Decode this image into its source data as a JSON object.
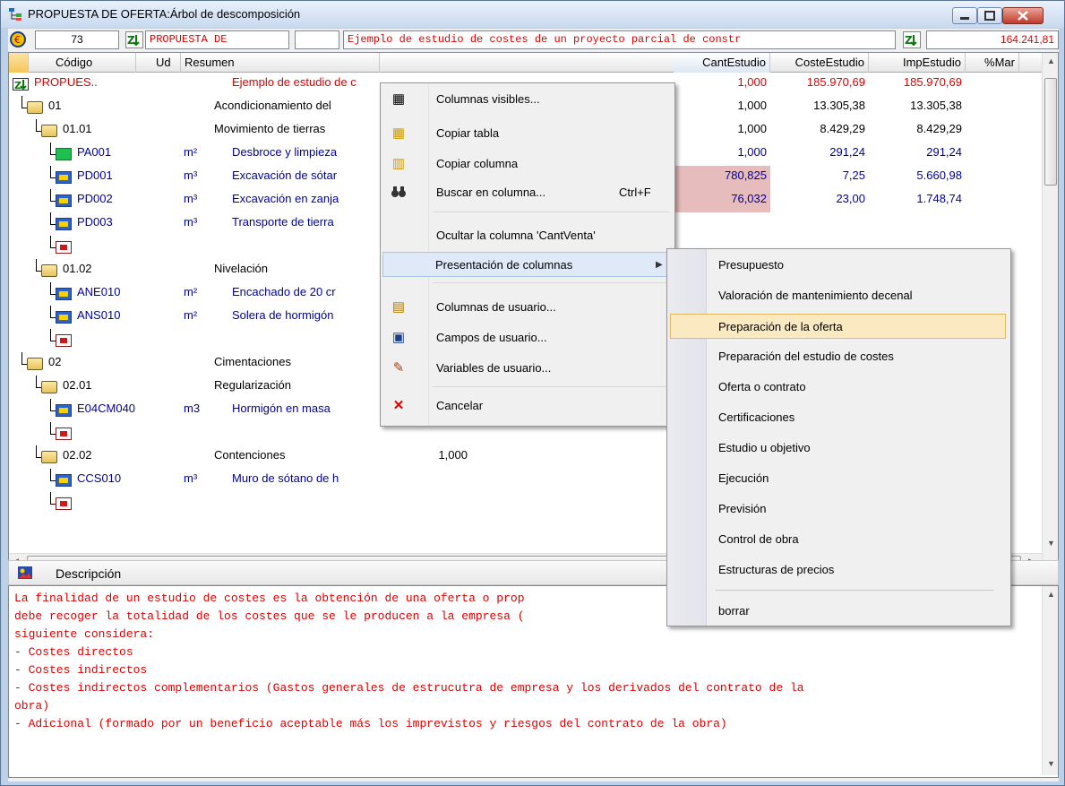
{
  "window": {
    "title": "PROPUESTA DE OFERTA:Árbol de descomposición"
  },
  "toolbar": {
    "count": "73",
    "code": "PROPUESTA DE",
    "unit": "",
    "summary": "Ejemplo de estudio de costes de un proyecto parcial de constr",
    "total": "164.241,81"
  },
  "grid": {
    "columns": [
      "Código",
      "Ud",
      "Resumen",
      "CantEstudio",
      "CosteEstudio",
      "ImpEstudio",
      "%Mar"
    ],
    "rows": [
      {
        "code": "PROPUES..",
        "ud": "",
        "summary": "Ejemplo de estudio de c",
        "cant": "1,000",
        "coste": "185.970,69",
        "imp": "185.970,69",
        "style": "red"
      },
      {
        "code": "01",
        "ud": "",
        "summary": "Acondicionamiento del",
        "cant": "1,000",
        "coste": "13.305,38",
        "imp": "13.305,38",
        "style": "black"
      },
      {
        "code": "01.01",
        "ud": "",
        "summary": "Movimiento de tierras",
        "cant": "1,000",
        "coste": "8.429,29",
        "imp": "8.429,29",
        "style": "black"
      },
      {
        "code": "PA001",
        "ud": "m²",
        "summary": "Desbroce y limpieza",
        "cant": "1,000",
        "coste": "291,24",
        "imp": "291,24",
        "style": "navy"
      },
      {
        "code": "PD001",
        "ud": "m³",
        "summary": "Excavación de sótar",
        "cant": "780,825",
        "coste": "7,25",
        "imp": "5.660,98",
        "style": "navy"
      },
      {
        "code": "PD002",
        "ud": "m³",
        "summary": "Excavación en zanja",
        "cant": "76,032",
        "coste": "23,00",
        "imp": "1.748,74",
        "style": "navy"
      },
      {
        "code": "PD003",
        "ud": "m³",
        "summary": "Transporte de tierra",
        "cant": "",
        "coste": "",
        "imp": "",
        "style": "navy"
      },
      {
        "code": "",
        "ud": "",
        "summary": "",
        "cant": "",
        "coste": "",
        "imp": "",
        "style": "navy"
      },
      {
        "code": "01.02",
        "ud": "",
        "summary": "Nivelación",
        "cant": "",
        "coste": "",
        "imp": "",
        "style": "black"
      },
      {
        "code": "ANE010",
        "ud": "m²",
        "summary": "Encachado de 20 cr",
        "cant": "",
        "coste": "",
        "imp": "",
        "style": "navy"
      },
      {
        "code": "ANS010",
        "ud": "m²",
        "summary": "Solera de hormigón",
        "cant": "",
        "coste": "",
        "imp": "",
        "style": "navy"
      },
      {
        "code": "",
        "ud": "",
        "summary": "",
        "cant": "",
        "coste": "",
        "imp": "",
        "style": "navy"
      },
      {
        "code": "02",
        "ud": "",
        "summary": "Cimentaciones",
        "cant": "",
        "coste": "",
        "imp": "",
        "style": "black"
      },
      {
        "code": "02.01",
        "ud": "",
        "summary": "Regularización",
        "cant": "",
        "coste": "",
        "imp": "",
        "style": "black"
      },
      {
        "code": "E04CM040",
        "ud": "m3",
        "summary": "Hormigón en masa",
        "cant": "",
        "coste": "",
        "imp": "",
        "style": "navy"
      },
      {
        "code": "",
        "ud": "",
        "summary": "",
        "cant": "",
        "coste": "",
        "imp": "",
        "style": "navy"
      },
      {
        "code": "02.02",
        "ud": "",
        "summary": "Contenciones",
        "cant": "1,000",
        "coste": "",
        "imp": "",
        "style": "black"
      },
      {
        "code": "CCS010",
        "ud": "m³",
        "summary": "Muro de sótano de h",
        "cant": "",
        "coste": "",
        "imp": "",
        "style": "navy"
      },
      {
        "code": "",
        "ud": "",
        "summary": "",
        "cant": "",
        "coste": "",
        "imp": "",
        "style": "navy"
      }
    ]
  },
  "context_menu": {
    "items": [
      {
        "label": "Columnas visibles...",
        "shortcut": "",
        "icon": "visible-columns-icon"
      },
      {
        "label": "Copiar tabla",
        "shortcut": "",
        "icon": "copy-table-icon"
      },
      {
        "label": "Copiar columna",
        "shortcut": "",
        "icon": "copy-column-icon"
      },
      {
        "label": "Buscar en columna...",
        "shortcut": "Ctrl+F",
        "icon": "binoculars-icon"
      },
      {
        "label": "Ocultar la columna 'CantVenta'",
        "shortcut": "",
        "icon": ""
      },
      {
        "label": "Presentación de columnas",
        "shortcut": "",
        "icon": ""
      },
      {
        "label": "Columnas de usuario...",
        "shortcut": "",
        "icon": "user-columns-icon"
      },
      {
        "label": "Campos de usuario...",
        "shortcut": "",
        "icon": "user-fields-icon"
      },
      {
        "label": "Variables de usuario...",
        "shortcut": "",
        "icon": "user-variables-icon"
      },
      {
        "label": "Cancelar",
        "shortcut": "",
        "icon": "cancel-icon"
      }
    ]
  },
  "submenu": {
    "items": [
      "Presupuesto",
      "Valoración de mantenimiento decenal",
      "Preparación de la oferta",
      "Preparación del estudio de costes",
      "Oferta o contrato",
      "Certificaciones",
      "Estudio u objetivo",
      "Ejecución",
      "Previsión",
      "Control de obra",
      "Estructuras de precios",
      "borrar"
    ],
    "selected": "Preparación de la oferta"
  },
  "description": {
    "title": "Descripción",
    "lines": [
      "La finalidad de un estudio de costes es la obtención de una oferta o prop",
      "debe recoger la totalidad de los costes que se le producen a la empresa (",
      "siguiente considera:",
      "- Costes directos",
      "- Costes indirectos",
      "- Costes indirectos complementarios (Gastos generales de estrucutra de empresa y los derivados del contrato de la",
      "obra)",
      "- Adicional (formado por un beneficio aceptable más los imprevistos y riesgos del contrato de la obra)"
    ]
  },
  "colors": {
    "accent_red": "#e00000",
    "item_navy": "#0000a0",
    "cost_cell_bg": "#e7bcbc",
    "submenu_highlight": "#fbe9c2"
  }
}
